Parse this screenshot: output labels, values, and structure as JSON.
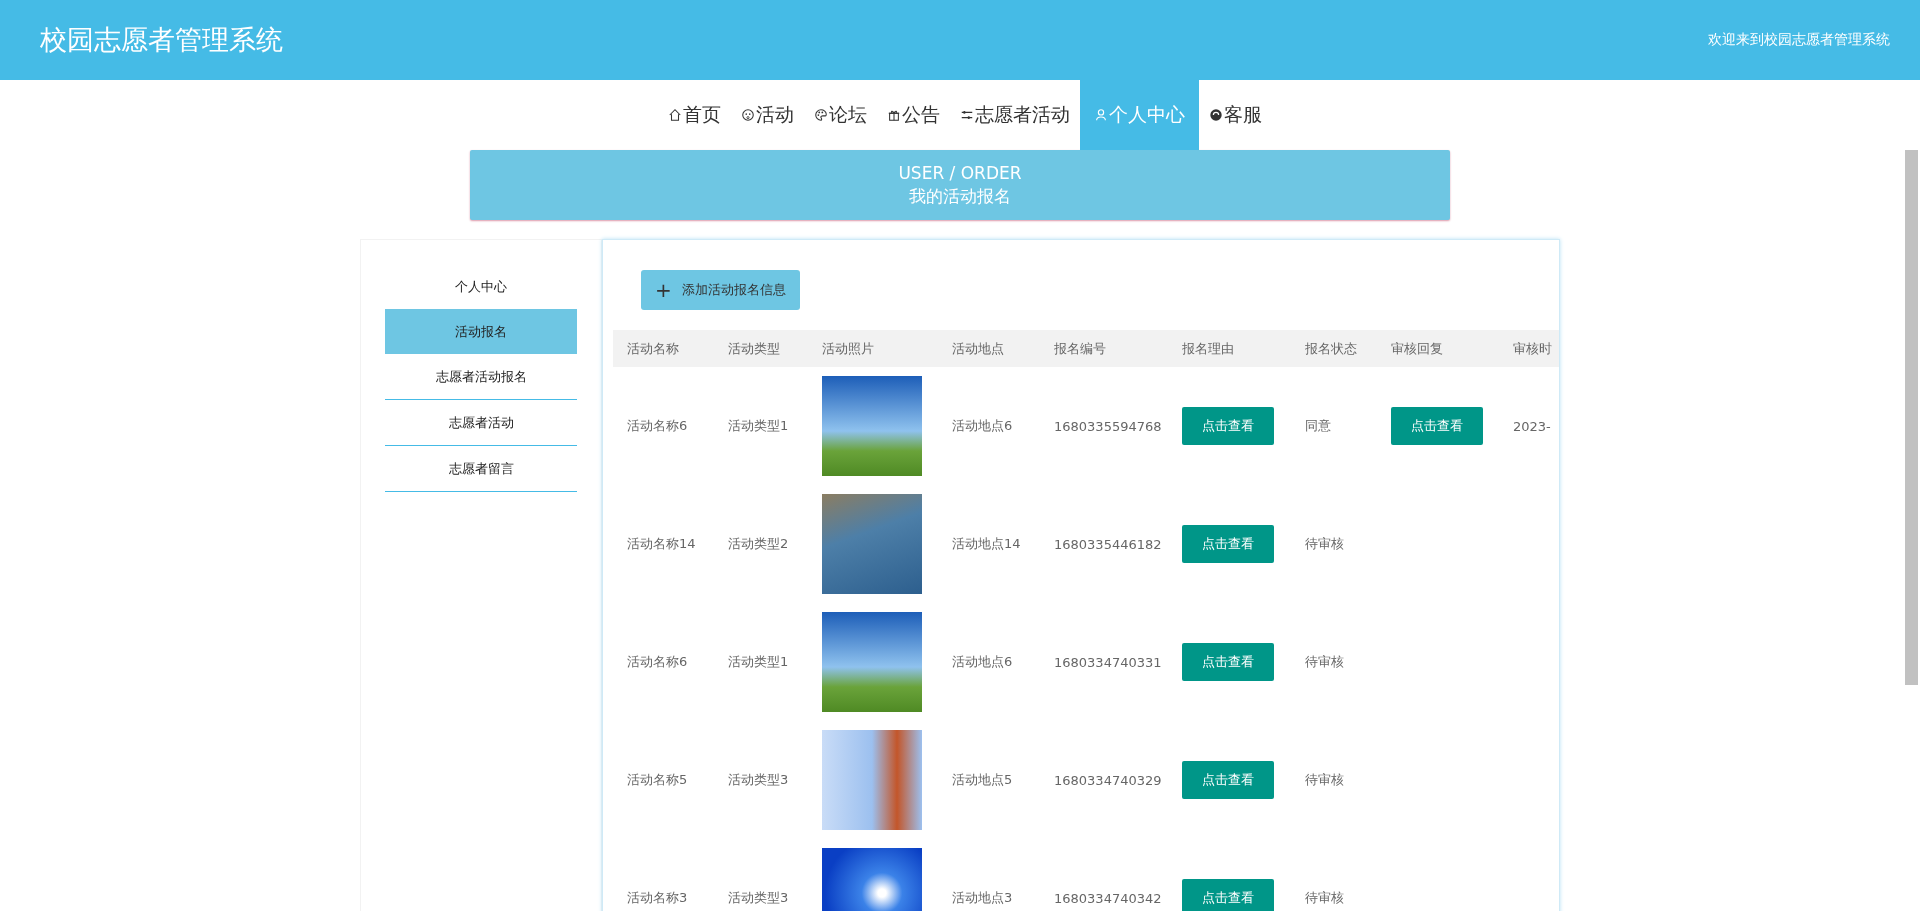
{
  "header": {
    "title": "校园志愿者管理系统",
    "welcome": "欢迎来到校园志愿者管理系统"
  },
  "nav": [
    {
      "label": "首页",
      "selected": false
    },
    {
      "label": "活动",
      "selected": false
    },
    {
      "label": "论坛",
      "selected": false
    },
    {
      "label": "公告",
      "selected": false
    },
    {
      "label": "志愿者活动",
      "selected": false
    },
    {
      "label": "个人中心",
      "selected": true
    },
    {
      "label": "客服",
      "selected": false
    }
  ],
  "banner": {
    "subtitle": "USER / ORDER",
    "title": "我的活动报名"
  },
  "sidebar": {
    "items": [
      {
        "label": "个人中心",
        "selected": false
      },
      {
        "label": "活动报名",
        "selected": true
      },
      {
        "label": "志愿者活动报名",
        "selected": false
      },
      {
        "label": "志愿者活动",
        "selected": false
      },
      {
        "label": "志愿者留言",
        "selected": false
      }
    ]
  },
  "add_button": {
    "icon": "+",
    "label": "添加活动报名信息"
  },
  "table": {
    "columns": [
      "活动名称",
      "活动类型",
      "活动照片",
      "活动地点",
      "报名编号",
      "报名理由",
      "报名状态",
      "审核回复",
      "审核时"
    ],
    "rows": [
      {
        "name": "活动名称6",
        "type": "活动类型1",
        "location": "活动地点6",
        "number": "1680335594768",
        "reason": "点击查看",
        "status": "同意",
        "reply": "点击查看",
        "time": "2023-"
      },
      {
        "name": "活动名称14",
        "type": "活动类型2",
        "location": "活动地点14",
        "number": "1680335446182",
        "reason": "点击查看",
        "status": "待审核"
      },
      {
        "name": "活动名称6",
        "type": "活动类型1",
        "location": "活动地点6",
        "number": "1680334740331",
        "reason": "点击查看",
        "status": "待审核"
      },
      {
        "name": "活动名称5",
        "type": "活动类型3",
        "location": "活动地点5",
        "number": "1680334740329",
        "reason": "点击查看",
        "status": "待审核"
      },
      {
        "name": "活动名称3",
        "type": "活动类型3",
        "location": "活动地点3",
        "number": "1680334740342",
        "reason": "点击查看",
        "status": "待审核"
      }
    ]
  }
}
